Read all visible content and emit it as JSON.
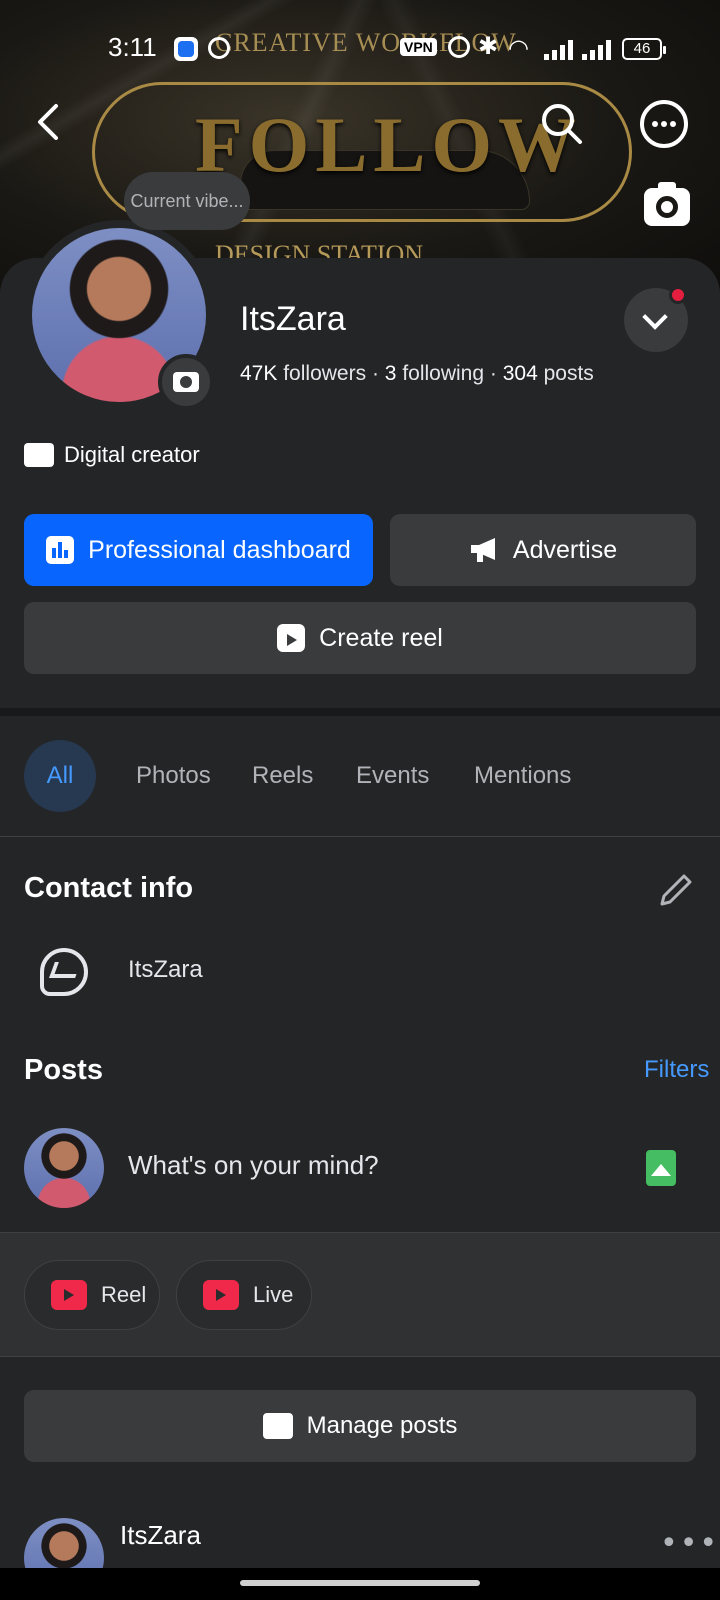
{
  "status_bar": {
    "time": "3:11",
    "vpn": "VPN",
    "battery": "46"
  },
  "cover": {
    "top_text": "CREATIVE WORKFLOW",
    "main_text": "FOLLOW",
    "bottom_text": "DESIGN STATION"
  },
  "profile": {
    "vibe_placeholder": "Current vibe...",
    "name": "ItsZara",
    "followers": "47K",
    "followers_label": "followers",
    "following": "3",
    "following_label": "following",
    "posts": "304",
    "posts_label": "posts",
    "separator": "·",
    "category": "Digital creator"
  },
  "actions": {
    "dashboard": "Professional dashboard",
    "advertise": "Advertise",
    "create_reel": "Create reel"
  },
  "tabs": [
    "All",
    "Photos",
    "Reels",
    "Events",
    "Mentions"
  ],
  "contact": {
    "title": "Contact info",
    "messenger_name": "ItsZara"
  },
  "posts_section": {
    "title": "Posts",
    "filters": "Filters",
    "composer_placeholder": "What's on your mind?",
    "chips": [
      "Reel",
      "Live"
    ],
    "manage": "Manage posts"
  },
  "feed": {
    "first_post_author": "ItsZara"
  },
  "colors": {
    "accent": "#0866ff",
    "link": "#4599ff",
    "background": "#242526",
    "surface": "#3a3b3c",
    "notification": "#e41e3f",
    "photo_green": "#45bd62",
    "video_red": "#f02849"
  }
}
